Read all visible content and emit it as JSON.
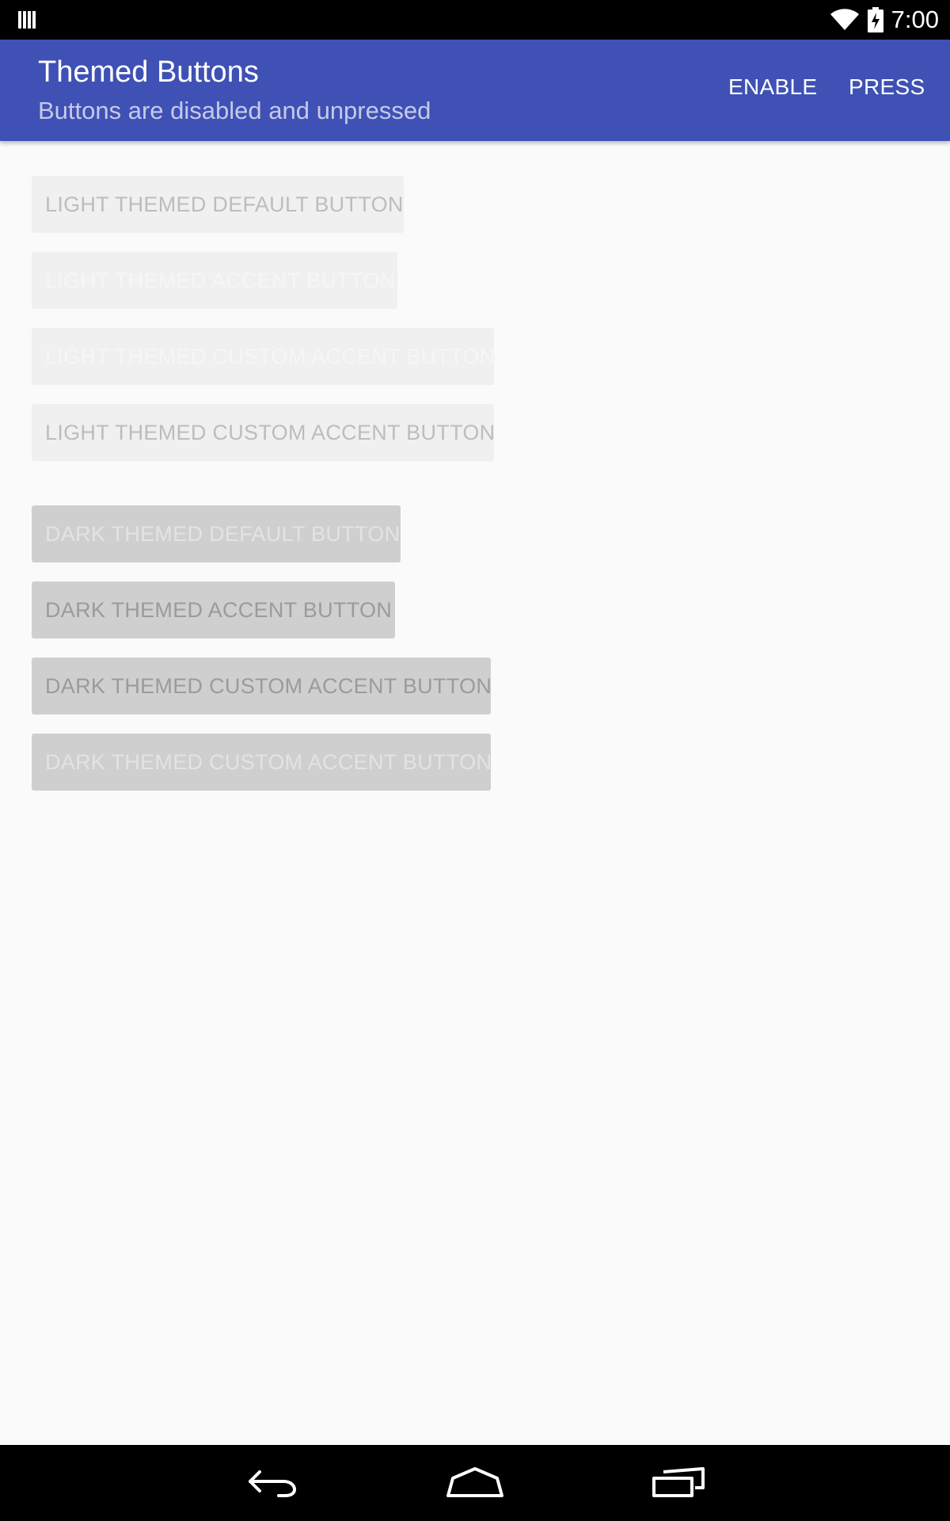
{
  "status_bar": {
    "left_icon": "notification-barcode-icon",
    "wifi_icon": "wifi-icon",
    "battery_icon": "battery-charging-icon",
    "time": "7:00"
  },
  "app_bar": {
    "title": "Themed Buttons",
    "subtitle": "Buttons are disabled and unpressed",
    "actions": [
      "ENABLE",
      "PRESS"
    ],
    "background_color": "#3f51b5"
  },
  "buttons": {
    "light_default": "LIGHT THEMED DEFAULT BUTTON",
    "light_accent": "LIGHT THEMED ACCENT BUTTON",
    "light_custom_accent_1": "LIGHT THEMED CUSTOM ACCENT BUTTON",
    "light_custom_accent_2": "LIGHT THEMED CUSTOM ACCENT BUTTON",
    "dark_default": "DARK THEMED DEFAULT BUTTON",
    "dark_accent": "DARK THEMED ACCENT BUTTON",
    "dark_custom_accent_1": "DARK THEMED CUSTOM ACCENT BUTTON",
    "dark_custom_accent_2": "DARK THEMED CUSTOM ACCENT BUTTON"
  },
  "nav_bar": {
    "back_icon": "back-icon",
    "home_icon": "home-icon",
    "recents_icon": "recents-icon"
  }
}
